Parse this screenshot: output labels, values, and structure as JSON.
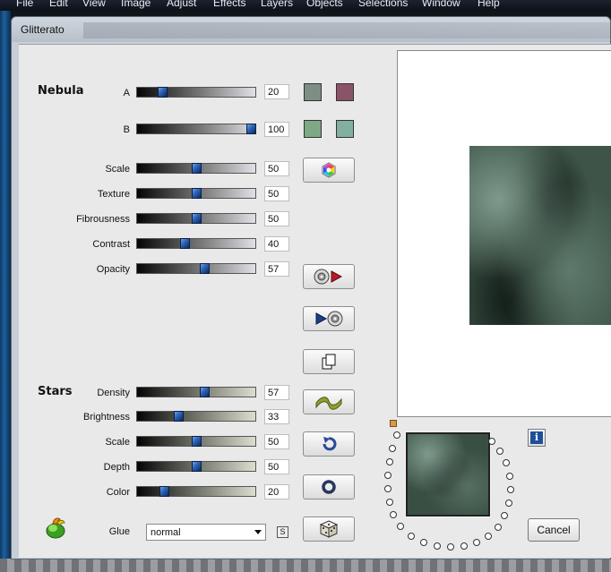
{
  "menu": [
    "File",
    "Edit",
    "View",
    "Image",
    "Adjust",
    "Effects",
    "Layers",
    "Objects",
    "Selections",
    "Window",
    "Help"
  ],
  "dialog": {
    "title": "Glitterato"
  },
  "nebula": {
    "title": "Nebula",
    "rows": [
      {
        "label": "A",
        "value": "20"
      },
      {
        "label": "B",
        "value": "100"
      },
      {
        "label": "Scale",
        "value": "50"
      },
      {
        "label": "Texture",
        "value": "50"
      },
      {
        "label": "Fibrousness",
        "value": "50"
      },
      {
        "label": "Contrast",
        "value": "40"
      },
      {
        "label": "Opacity",
        "value": "57"
      }
    ],
    "swatches": [
      "#7d8f85",
      "#8a5468",
      "#7ea985",
      "#82b0a0"
    ]
  },
  "stars": {
    "title": "Stars",
    "rows": [
      {
        "label": "Density",
        "value": "57"
      },
      {
        "label": "Brightness",
        "value": "33"
      },
      {
        "label": "Scale",
        "value": "50"
      },
      {
        "label": "Depth",
        "value": "50"
      },
      {
        "label": "Color",
        "value": "20"
      }
    ]
  },
  "glue": {
    "label": "Glue",
    "value": "normal",
    "s_label": "S"
  },
  "buttons": {
    "cancel": "Cancel",
    "info": "i"
  },
  "icons": {
    "color_wheel": "hexagon-color-wheel-icon",
    "save_preset": "disc-arrow-right-icon",
    "load_preset": "arrow-disc-icon",
    "copy": "copy-icon",
    "wave": "wave-icon",
    "undo": "undo-arrow-icon",
    "reset": "ring-icon",
    "random": "dice-icon"
  }
}
